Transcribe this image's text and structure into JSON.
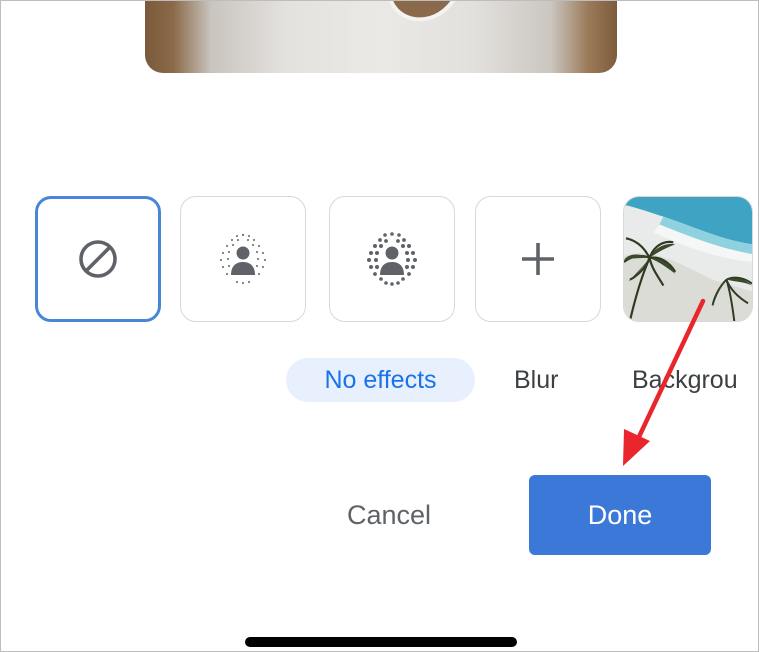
{
  "effects": {
    "labels": {
      "no_effects": "No effects",
      "blur": "Blur",
      "background": "Backgrou"
    },
    "tiles": [
      {
        "name": "no-effects",
        "icon": "prohibited-icon",
        "selected": true
      },
      {
        "name": "slight-blur",
        "icon": "slight-blur-person-icon",
        "selected": false
      },
      {
        "name": "blur",
        "icon": "blur-person-icon",
        "selected": false
      },
      {
        "name": "add-background",
        "icon": "plus-icon",
        "selected": false
      },
      {
        "name": "beach-background",
        "icon": "beach-thumbnail",
        "selected": false
      }
    ]
  },
  "actions": {
    "cancel_label": "Cancel",
    "done_label": "Done"
  },
  "colors": {
    "accent": "#3c78d8",
    "selected_border": "#4a86d8",
    "chip_bg": "#e8f0fe",
    "chip_text": "#1a73e8",
    "annotation_arrow": "#e8262b"
  }
}
